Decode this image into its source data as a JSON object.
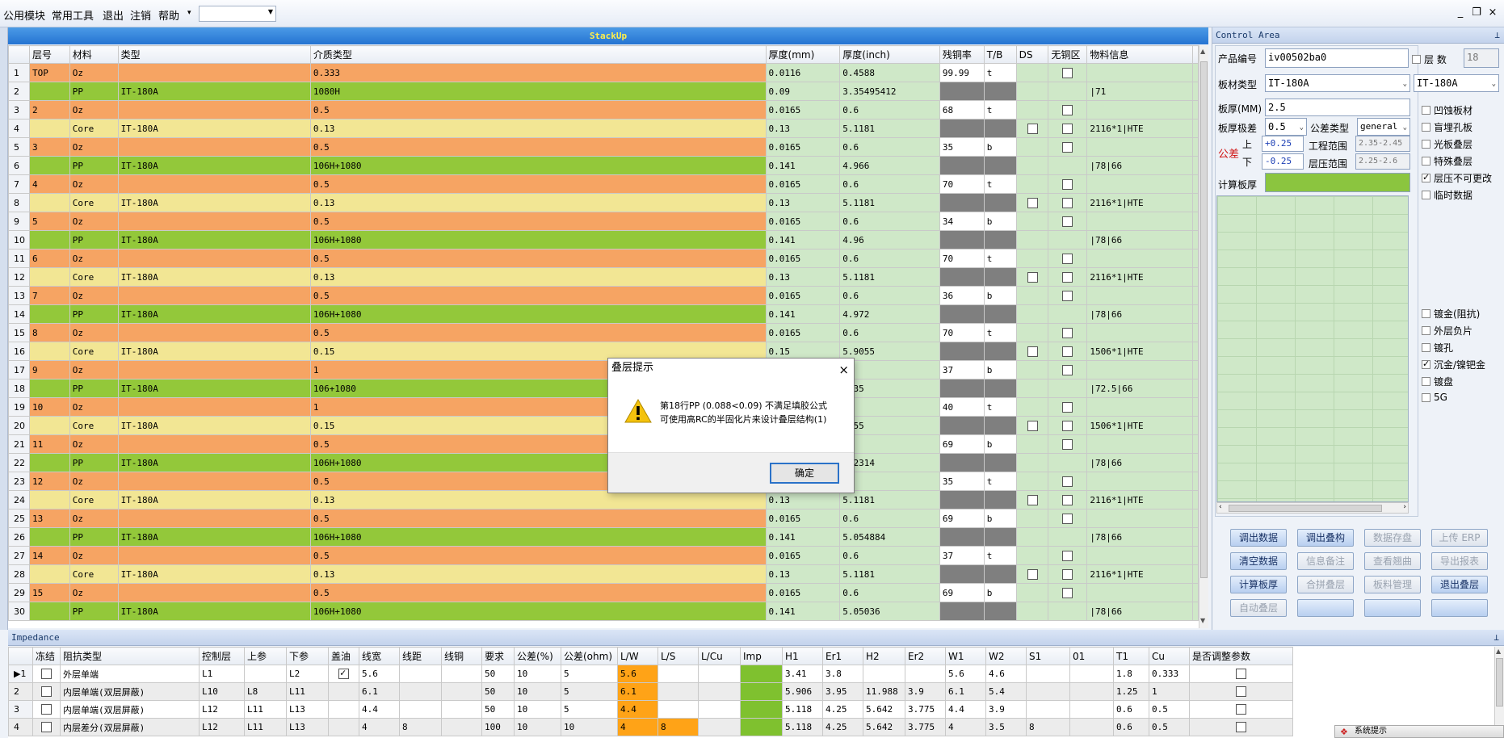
{
  "menu": {
    "items": [
      "公用模块",
      "常用工具",
      "退出",
      "注销",
      "帮助"
    ],
    "combo_value": "",
    "win": [
      "_",
      "❐",
      "×"
    ]
  },
  "stackup": {
    "title": "StackUp",
    "columns": [
      "层号",
      "材料",
      "类型",
      "介质类型",
      "厚度(mm)",
      "厚度(inch)",
      "残铜率",
      "T/B",
      "DS",
      "无铜区",
      "物料信息"
    ],
    "rows": [
      {
        "n": "1",
        "layer": "TOP",
        "mat": "Oz",
        "type": "",
        "diel": "0.333",
        "mm": "0.0116",
        "inch": "0.4588",
        "res": "99.99",
        "tb": "t",
        "ds": "",
        "nocu": true,
        "info": "",
        "c": "or"
      },
      {
        "n": "2",
        "layer": "",
        "mat": "PP",
        "type": "IT-180A",
        "diel": "1080H",
        "mm": "0.09",
        "inch": "3.35495412",
        "res": "",
        "tb": "",
        "ds": "",
        "nocu": false,
        "info": "|71",
        "c": "gr"
      },
      {
        "n": "3",
        "layer": "2",
        "mat": "Oz",
        "type": "",
        "diel": "0.5",
        "mm": "0.0165",
        "inch": "0.6",
        "res": "68",
        "tb": "t",
        "ds": "",
        "nocu": true,
        "info": "",
        "c": "or"
      },
      {
        "n": "4",
        "layer": "",
        "mat": "Core",
        "type": "IT-180A",
        "diel": "0.13",
        "mm": "0.13",
        "inch": "5.1181",
        "res": "",
        "tb": "",
        "ds": "x",
        "nocu": true,
        "info": "2116*1|HTE",
        "c": "ye"
      },
      {
        "n": "5",
        "layer": "3",
        "mat": "Oz",
        "type": "",
        "diel": "0.5",
        "mm": "0.0165",
        "inch": "0.6",
        "res": "35",
        "tb": "b",
        "ds": "",
        "nocu": true,
        "info": "",
        "c": "or"
      },
      {
        "n": "6",
        "layer": "",
        "mat": "PP",
        "type": "IT-180A",
        "diel": "106H+1080",
        "mm": "0.141",
        "inch": "4.966",
        "res": "",
        "tb": "",
        "ds": "",
        "nocu": false,
        "info": "|78|66",
        "c": "gr"
      },
      {
        "n": "7",
        "layer": "4",
        "mat": "Oz",
        "type": "",
        "diel": "0.5",
        "mm": "0.0165",
        "inch": "0.6",
        "res": "70",
        "tb": "t",
        "ds": "",
        "nocu": true,
        "info": "",
        "c": "or"
      },
      {
        "n": "8",
        "layer": "",
        "mat": "Core",
        "type": "IT-180A",
        "diel": "0.13",
        "mm": "0.13",
        "inch": "5.1181",
        "res": "",
        "tb": "",
        "ds": "x",
        "nocu": true,
        "info": "2116*1|HTE",
        "c": "ye"
      },
      {
        "n": "9",
        "layer": "5",
        "mat": "Oz",
        "type": "",
        "diel": "0.5",
        "mm": "0.0165",
        "inch": "0.6",
        "res": "34",
        "tb": "b",
        "ds": "",
        "nocu": true,
        "info": "",
        "c": "or"
      },
      {
        "n": "10",
        "layer": "",
        "mat": "PP",
        "type": "IT-180A",
        "diel": "106H+1080",
        "mm": "0.141",
        "inch": "4.96",
        "res": "",
        "tb": "",
        "ds": "",
        "nocu": false,
        "info": "|78|66",
        "c": "gr"
      },
      {
        "n": "11",
        "layer": "6",
        "mat": "Oz",
        "type": "",
        "diel": "0.5",
        "mm": "0.0165",
        "inch": "0.6",
        "res": "70",
        "tb": "t",
        "ds": "",
        "nocu": true,
        "info": "",
        "c": "or"
      },
      {
        "n": "12",
        "layer": "",
        "mat": "Core",
        "type": "IT-180A",
        "diel": "0.13",
        "mm": "0.13",
        "inch": "5.1181",
        "res": "",
        "tb": "",
        "ds": "x",
        "nocu": true,
        "info": "2116*1|HTE",
        "c": "ye"
      },
      {
        "n": "13",
        "layer": "7",
        "mat": "Oz",
        "type": "",
        "diel": "0.5",
        "mm": "0.0165",
        "inch": "0.6",
        "res": "36",
        "tb": "b",
        "ds": "",
        "nocu": true,
        "info": "",
        "c": "or"
      },
      {
        "n": "14",
        "layer": "",
        "mat": "PP",
        "type": "IT-180A",
        "diel": "106H+1080",
        "mm": "0.141",
        "inch": "4.972",
        "res": "",
        "tb": "",
        "ds": "",
        "nocu": false,
        "info": "|78|66",
        "c": "gr"
      },
      {
        "n": "15",
        "layer": "8",
        "mat": "Oz",
        "type": "",
        "diel": "0.5",
        "mm": "0.0165",
        "inch": "0.6",
        "res": "70",
        "tb": "t",
        "ds": "",
        "nocu": true,
        "info": "",
        "c": "or"
      },
      {
        "n": "16",
        "layer": "",
        "mat": "Core",
        "type": "IT-180A",
        "diel": "0.15",
        "mm": "0.15",
        "inch": "5.9055",
        "res": "",
        "tb": "",
        "ds": "x",
        "nocu": true,
        "info": "1506*1|HTE",
        "c": "ye"
      },
      {
        "n": "17",
        "layer": "9",
        "mat": "Oz",
        "type": "",
        "diel": "1",
        "mm": "",
        "inch": "25",
        "res": "37",
        "tb": "b",
        "ds": "",
        "nocu": true,
        "info": "",
        "c": "or"
      },
      {
        "n": "18",
        "layer": "",
        "mat": "PP",
        "type": "IT-180A",
        "diel": "106+1080",
        "mm": "",
        "inch": "4735",
        "res": "",
        "tb": "",
        "ds": "",
        "nocu": false,
        "info": "|72.5|66",
        "c": "gr"
      },
      {
        "n": "19",
        "layer": "10",
        "mat": "Oz",
        "type": "",
        "diel": "1",
        "mm": "",
        "inch": "25",
        "res": "40",
        "tb": "t",
        "ds": "",
        "nocu": true,
        "info": "",
        "c": "or"
      },
      {
        "n": "20",
        "layer": "",
        "mat": "Core",
        "type": "IT-180A",
        "diel": "0.15",
        "mm": "",
        "inch": "9055",
        "res": "",
        "tb": "",
        "ds": "x",
        "nocu": true,
        "info": "1506*1|HTE",
        "c": "ye"
      },
      {
        "n": "21",
        "layer": "11",
        "mat": "Oz",
        "type": "",
        "diel": "0.5",
        "mm": "",
        "inch": "6",
        "res": "69",
        "tb": "b",
        "ds": "",
        "nocu": true,
        "info": "",
        "c": "or"
      },
      {
        "n": "22",
        "layer": "",
        "mat": "PP",
        "type": "IT-180A",
        "diel": "106H+1080",
        "mm": "",
        "inch": "042314",
        "res": "",
        "tb": "",
        "ds": "",
        "nocu": false,
        "info": "|78|66",
        "c": "gr"
      },
      {
        "n": "23",
        "layer": "12",
        "mat": "Oz",
        "type": "",
        "diel": "0.5",
        "mm": "",
        "inch": "6",
        "res": "35",
        "tb": "t",
        "ds": "",
        "nocu": true,
        "info": "",
        "c": "or"
      },
      {
        "n": "24",
        "layer": "",
        "mat": "Core",
        "type": "IT-180A",
        "diel": "0.13",
        "mm": "0.13",
        "inch": "5.1181",
        "res": "",
        "tb": "",
        "ds": "x",
        "nocu": true,
        "info": "2116*1|HTE",
        "c": "ye"
      },
      {
        "n": "25",
        "layer": "13",
        "mat": "Oz",
        "type": "",
        "diel": "0.5",
        "mm": "0.0165",
        "inch": "0.6",
        "res": "69",
        "tb": "b",
        "ds": "",
        "nocu": true,
        "info": "",
        "c": "or"
      },
      {
        "n": "26",
        "layer": "",
        "mat": "PP",
        "type": "IT-180A",
        "diel": "106H+1080",
        "mm": "0.141",
        "inch": "5.054884",
        "res": "",
        "tb": "",
        "ds": "",
        "nocu": false,
        "info": "|78|66",
        "c": "gr"
      },
      {
        "n": "27",
        "layer": "14",
        "mat": "Oz",
        "type": "",
        "diel": "0.5",
        "mm": "0.0165",
        "inch": "0.6",
        "res": "37",
        "tb": "t",
        "ds": "",
        "nocu": true,
        "info": "",
        "c": "or"
      },
      {
        "n": "28",
        "layer": "",
        "mat": "Core",
        "type": "IT-180A",
        "diel": "0.13",
        "mm": "0.13",
        "inch": "5.1181",
        "res": "",
        "tb": "",
        "ds": "x",
        "nocu": true,
        "info": "2116*1|HTE",
        "c": "ye"
      },
      {
        "n": "29",
        "layer": "15",
        "mat": "Oz",
        "type": "",
        "diel": "0.5",
        "mm": "0.0165",
        "inch": "0.6",
        "res": "69",
        "tb": "b",
        "ds": "",
        "nocu": true,
        "info": "",
        "c": "or"
      },
      {
        "n": "30",
        "layer": "",
        "mat": "PP",
        "type": "IT-180A",
        "diel": "106H+1080",
        "mm": "0.141",
        "inch": "5.05036",
        "res": "",
        "tb": "",
        "ds": "",
        "nocu": false,
        "info": "|78|66",
        "c": "gr"
      }
    ]
  },
  "control": {
    "title": "Control Area",
    "product_label": "产品编号",
    "product_value": "iv00502ba0",
    "layers_label": "层 数",
    "layers_value": "18",
    "board_type_label": "板材类型",
    "board_type_value": "IT-180A",
    "board_type_value2": "IT-180A",
    "thickness_label": "板厚(MM)",
    "thickness_value": "2.5",
    "thick_tol_label": "板厚极差",
    "thick_tol_value": "0.5",
    "tol_type_label": "公差类型",
    "tol_type_value": "general",
    "tol_label": "公差",
    "upper_label": "上",
    "lower_label": "下",
    "upper_value": "+0.25",
    "lower_value": "-0.25",
    "eng_range_label": "工程范围",
    "eng_range_value": "2.35-2.45",
    "press_range_label": "层压范围",
    "press_range_value": "2.25-2.6",
    "calc_thick_label": "计算板厚",
    "calc_thick_value": "",
    "options": [
      {
        "label": "凹蚀板材",
        "checked": false
      },
      {
        "label": "盲埋孔板",
        "checked": false
      },
      {
        "label": "光板叠层",
        "checked": false
      },
      {
        "label": "特殊叠层",
        "checked": false
      },
      {
        "label": "层压不可更改",
        "checked": true
      },
      {
        "label": "临时数据",
        "checked": false
      },
      {
        "label": "镀金(阻抗)",
        "checked": false
      },
      {
        "label": "外层负片",
        "checked": false
      },
      {
        "label": "镀孔",
        "checked": false
      },
      {
        "label": "沉金/镍钯金",
        "checked": true
      },
      {
        "label": "镀盘",
        "checked": false
      },
      {
        "label": "5G",
        "checked": false
      }
    ],
    "buttons": [
      {
        "label": "调出数据",
        "enabled": true
      },
      {
        "label": "调出叠构",
        "enabled": true
      },
      {
        "label": "数据存盘",
        "enabled": false
      },
      {
        "label": "上传 ERP",
        "enabled": false
      },
      {
        "label": "清空数据",
        "enabled": true
      },
      {
        "label": "信息备注",
        "enabled": false
      },
      {
        "label": "查看翘曲",
        "enabled": false
      },
      {
        "label": "导出报表",
        "enabled": false
      },
      {
        "label": "计算板厚",
        "enabled": true
      },
      {
        "label": "合拼叠层",
        "enabled": false
      },
      {
        "label": "板料管理",
        "enabled": false
      },
      {
        "label": "退出叠层",
        "enabled": true
      },
      {
        "label": "自动叠层",
        "enabled": false
      },
      {
        "label": "",
        "enabled": true
      },
      {
        "label": "",
        "enabled": true
      },
      {
        "label": "",
        "enabled": true
      }
    ]
  },
  "impedance": {
    "title": "Impedance",
    "columns": [
      "冻结",
      "阻抗类型",
      "控制层",
      "上参",
      "下参",
      "盖油",
      "线宽",
      "线距",
      "线铜",
      "要求",
      "公差(%)",
      "公差(ohm)",
      "L/W",
      "L/S",
      "L/Cu",
      "Imp",
      "H1",
      "Er1",
      "H2",
      "Er2",
      "W1",
      "W2",
      "S1",
      "01",
      "T1",
      "Cu",
      "是否调整参数"
    ],
    "rows": [
      {
        "rn": "▶1",
        "cells": [
          "",
          "外层单端",
          "L1",
          "",
          "L2",
          "on",
          "5.6",
          "",
          "",
          "50",
          "10",
          "5",
          "5.6",
          "",
          "",
          "",
          "3.41",
          "3.8",
          "",
          "",
          "5.6",
          "4.6",
          "",
          "",
          "1.8",
          "0.333",
          "x"
        ]
      },
      {
        "rn": "2",
        "cells": [
          "",
          "内层单端(双层屏蔽)",
          "L10",
          "L8",
          "L11",
          "",
          "6.1",
          "",
          "",
          "50",
          "10",
          "5",
          "6.1",
          "",
          "",
          "",
          "5.906",
          "3.95",
          "11.988",
          "3.9",
          "6.1",
          "5.4",
          "",
          "",
          "1.25",
          "1",
          "x"
        ]
      },
      {
        "rn": "3",
        "cells": [
          "",
          "内层单端(双层屏蔽)",
          "L12",
          "L11",
          "L13",
          "",
          "4.4",
          "",
          "",
          "50",
          "10",
          "5",
          "4.4",
          "",
          "",
          "",
          "5.118",
          "4.25",
          "5.642",
          "3.775",
          "4.4",
          "3.9",
          "",
          "",
          "0.6",
          "0.5",
          "x"
        ]
      },
      {
        "rn": "4",
        "cells": [
          "",
          "内层差分(双层屏蔽)",
          "L12",
          "L11",
          "L13",
          "",
          "4",
          "8",
          "",
          "100",
          "10",
          "10",
          "4",
          "8",
          "",
          "",
          "5.118",
          "4.25",
          "5.642",
          "3.775",
          "4",
          "3.5",
          "8",
          "",
          "0.6",
          "0.5",
          "x"
        ]
      }
    ]
  },
  "dialog": {
    "title": "叠层提示",
    "line1": "第18行PP (0.088<0.09) 不满足填胶公式",
    "line2": "可使用高RC的半固化片来设计叠层结构(1)",
    "ok": "确定",
    "close": "×"
  },
  "tray": {
    "text": "系统提示"
  },
  "colors": {
    "copper": "#f6a463",
    "pp": "#93c83a",
    "core": "#f2e694",
    "light_green": "#cfe8c8",
    "grey_cell": "#7f7f7f",
    "header_blue": "#2573d2",
    "header_text": "#ffef4a",
    "lw_orange": "#ffa317"
  }
}
